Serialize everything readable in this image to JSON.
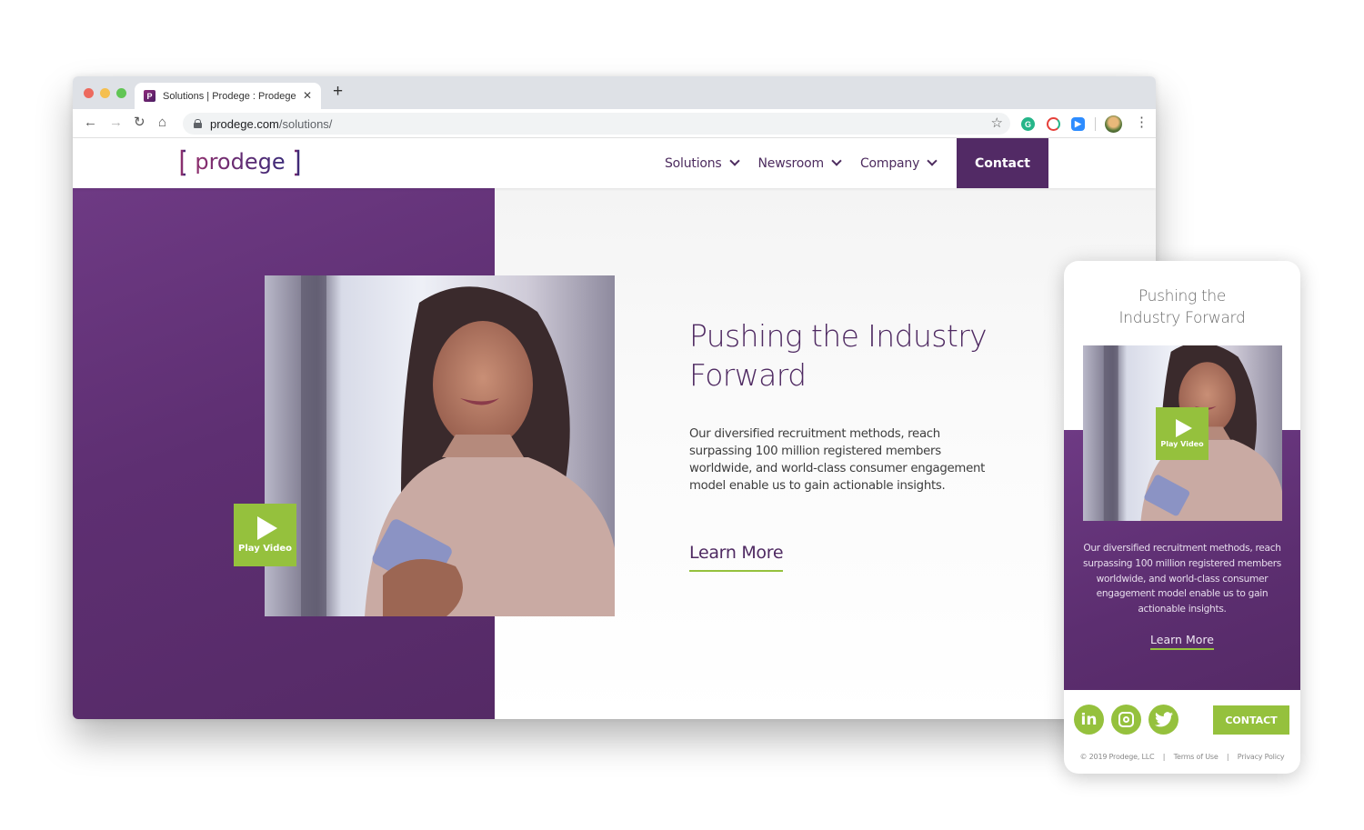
{
  "browser": {
    "tab_title": "Solutions | Prodege : Prodege",
    "favicon_letter": "P",
    "close_glyph": "✕",
    "new_tab_glyph": "+",
    "url_domain": "prodege.com",
    "url_path": "/solutions/",
    "nav": {
      "back": "←",
      "forward": "→",
      "reload": "↻",
      "home": "⌂",
      "star": "☆",
      "menu": "⋮"
    },
    "extensions": [
      {
        "name": "grammarly",
        "glyph": "G",
        "color": "#25b589"
      },
      {
        "name": "cookie-extension",
        "glyph": "",
        "color": "#e6403a"
      },
      {
        "name": "zoom",
        "glyph": "▶",
        "color": "#2d8cff"
      }
    ]
  },
  "site": {
    "logo_text": "prodege",
    "nav": [
      {
        "label": "Solutions"
      },
      {
        "label": "Newsroom"
      },
      {
        "label": "Company"
      }
    ],
    "contact_label": "Contact",
    "hero": {
      "title": "Pushing the Industry Forward",
      "body": "Our diversified recruitment methods, reach surpassing 100 million registered members worldwide, and world-class consumer engagement model enable us to gain actionable insights.",
      "cta": "Learn More",
      "play_label": "Play Video"
    },
    "colors": {
      "purple": "#522a65",
      "green": "#95c13d",
      "text_purple": "#4f2a62"
    }
  },
  "mobile": {
    "title_line1": "Pushing the",
    "title_line2": "Industry Forward",
    "play_label": "Play Video",
    "body": "Our diversified recruitment methods, reach surpassing 100 million registered members worldwide, and world-class consumer engagement model enable us to gain actionable insights.",
    "cta": "Learn More",
    "social": [
      {
        "name": "linkedin",
        "glyph": "in"
      },
      {
        "name": "instagram",
        "glyph": ""
      },
      {
        "name": "twitter",
        "glyph": ""
      }
    ],
    "contact_label": "CONTACT",
    "footer": {
      "copyright": "© 2019 Prodege, LLC",
      "separator": "|",
      "terms": "Terms of Use",
      "privacy": "Privacy Policy"
    }
  }
}
